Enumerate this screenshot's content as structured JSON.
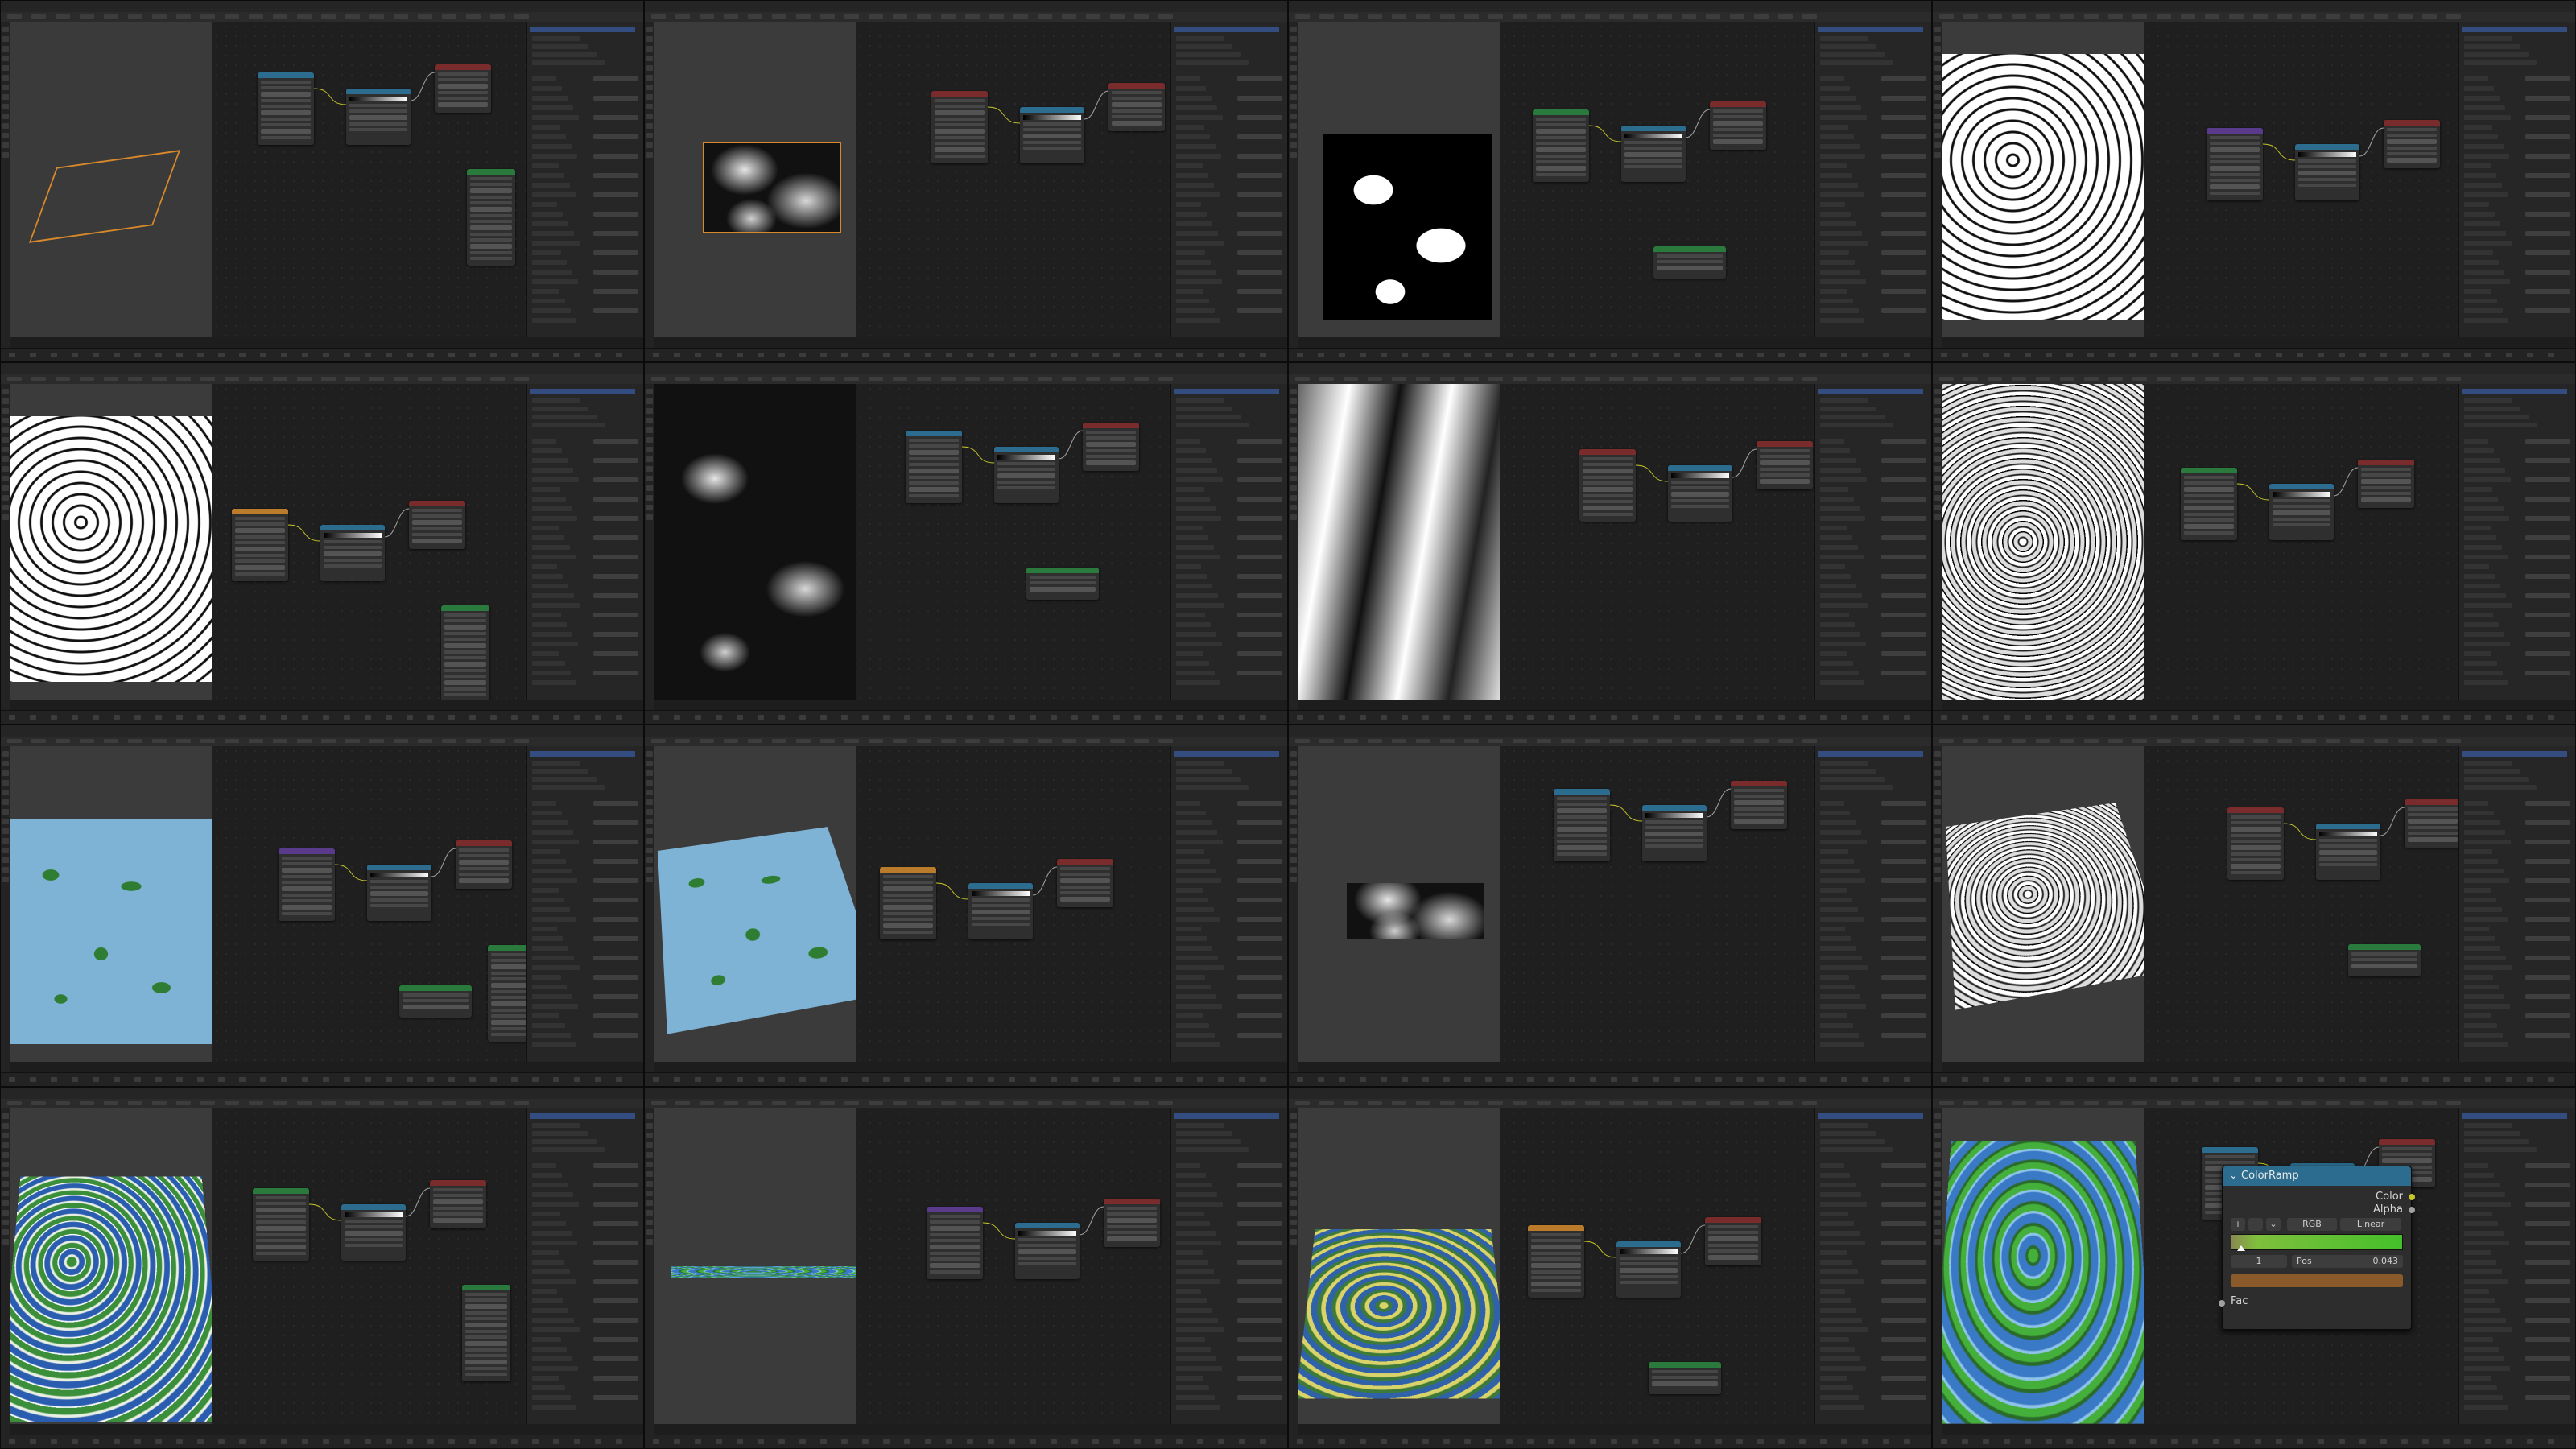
{
  "colorramp_node": {
    "title": "ColorRamp",
    "outputs": [
      "Color",
      "Alpha"
    ],
    "color_mode": "RGB",
    "interpolation": "Linear",
    "add_symbol": "+",
    "remove_symbol": "−",
    "menu_symbol": "⌄",
    "stop_index": "1",
    "pos_label": "Pos",
    "pos_value": "0.043",
    "input": "Fac",
    "colors": {
      "header": "#2c6d8f",
      "ramp_start": "#8a8a50",
      "ramp_end": "#44c02a",
      "stop_color": "#8a5a2a",
      "socket_color": "#c7c729",
      "socket_fac": "#a1a1a1"
    }
  },
  "panels": [
    {
      "id": 1,
      "scene": "plane-wireframe"
    },
    {
      "id": 2,
      "scene": "soft-noise-plane"
    },
    {
      "id": 3,
      "scene": "bw-noise-colorramp"
    },
    {
      "id": 4,
      "scene": "contour-noise"
    },
    {
      "id": 5,
      "scene": "contour-stripes-compare"
    },
    {
      "id": 6,
      "scene": "soft-noise-closeup"
    },
    {
      "id": 7,
      "scene": "stripes-wave"
    },
    {
      "id": 8,
      "scene": "rough-contour"
    },
    {
      "id": 9,
      "scene": "water-green-map"
    },
    {
      "id": 10,
      "scene": "water-green-perspective"
    },
    {
      "id": 11,
      "scene": "displaced-strip"
    },
    {
      "id": 12,
      "scene": "rough-displaced"
    },
    {
      "id": 13,
      "scene": "terrain-blue-white"
    },
    {
      "id": 14,
      "scene": "green-strip"
    },
    {
      "id": 15,
      "scene": "terrain-yellow-green"
    },
    {
      "id": 16,
      "scene": "terrain-green-blue-colorramp"
    }
  ],
  "icons": [
    "cursor-hand-icon"
  ]
}
